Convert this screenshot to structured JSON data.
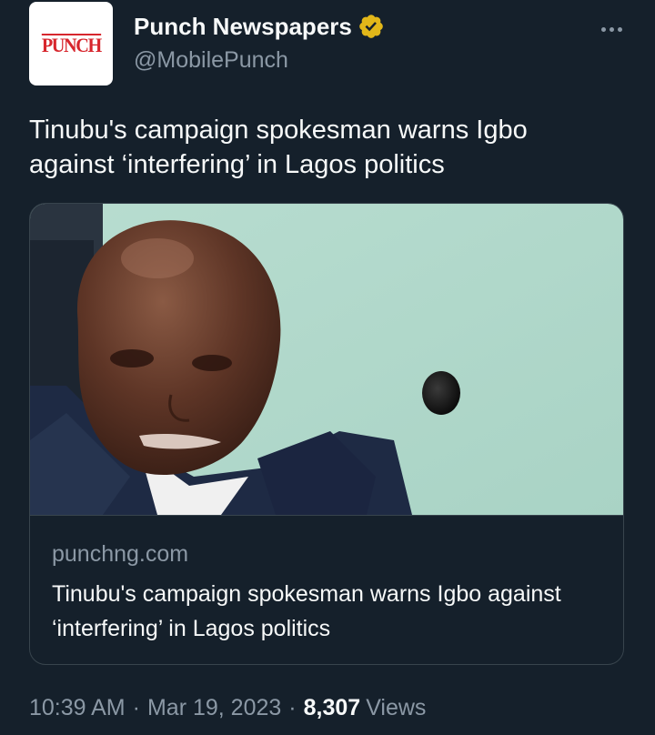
{
  "account": {
    "avatar_text": "PUNCH",
    "name": "Punch Newspapers",
    "handle": "@MobilePunch",
    "verified_badge_color": "#e2b719"
  },
  "tweet": {
    "text": "Tinubu's campaign spokesman warns Igbo against ‘interfering’ in Lagos politics"
  },
  "card": {
    "image_alt": "photo",
    "domain": "punchng.com",
    "title": "Tinubu's campaign spokesman warns Igbo against ‘interfering’ in Lagos politics"
  },
  "meta": {
    "time": "10:39 AM",
    "separator": "·",
    "date": "Mar 19, 2023",
    "views_count": "8,307",
    "views_label": "Views"
  },
  "colors": {
    "background": "#15202b",
    "text_primary": "#f7f9f9",
    "text_secondary": "#8b98a5",
    "border": "#38444d"
  }
}
